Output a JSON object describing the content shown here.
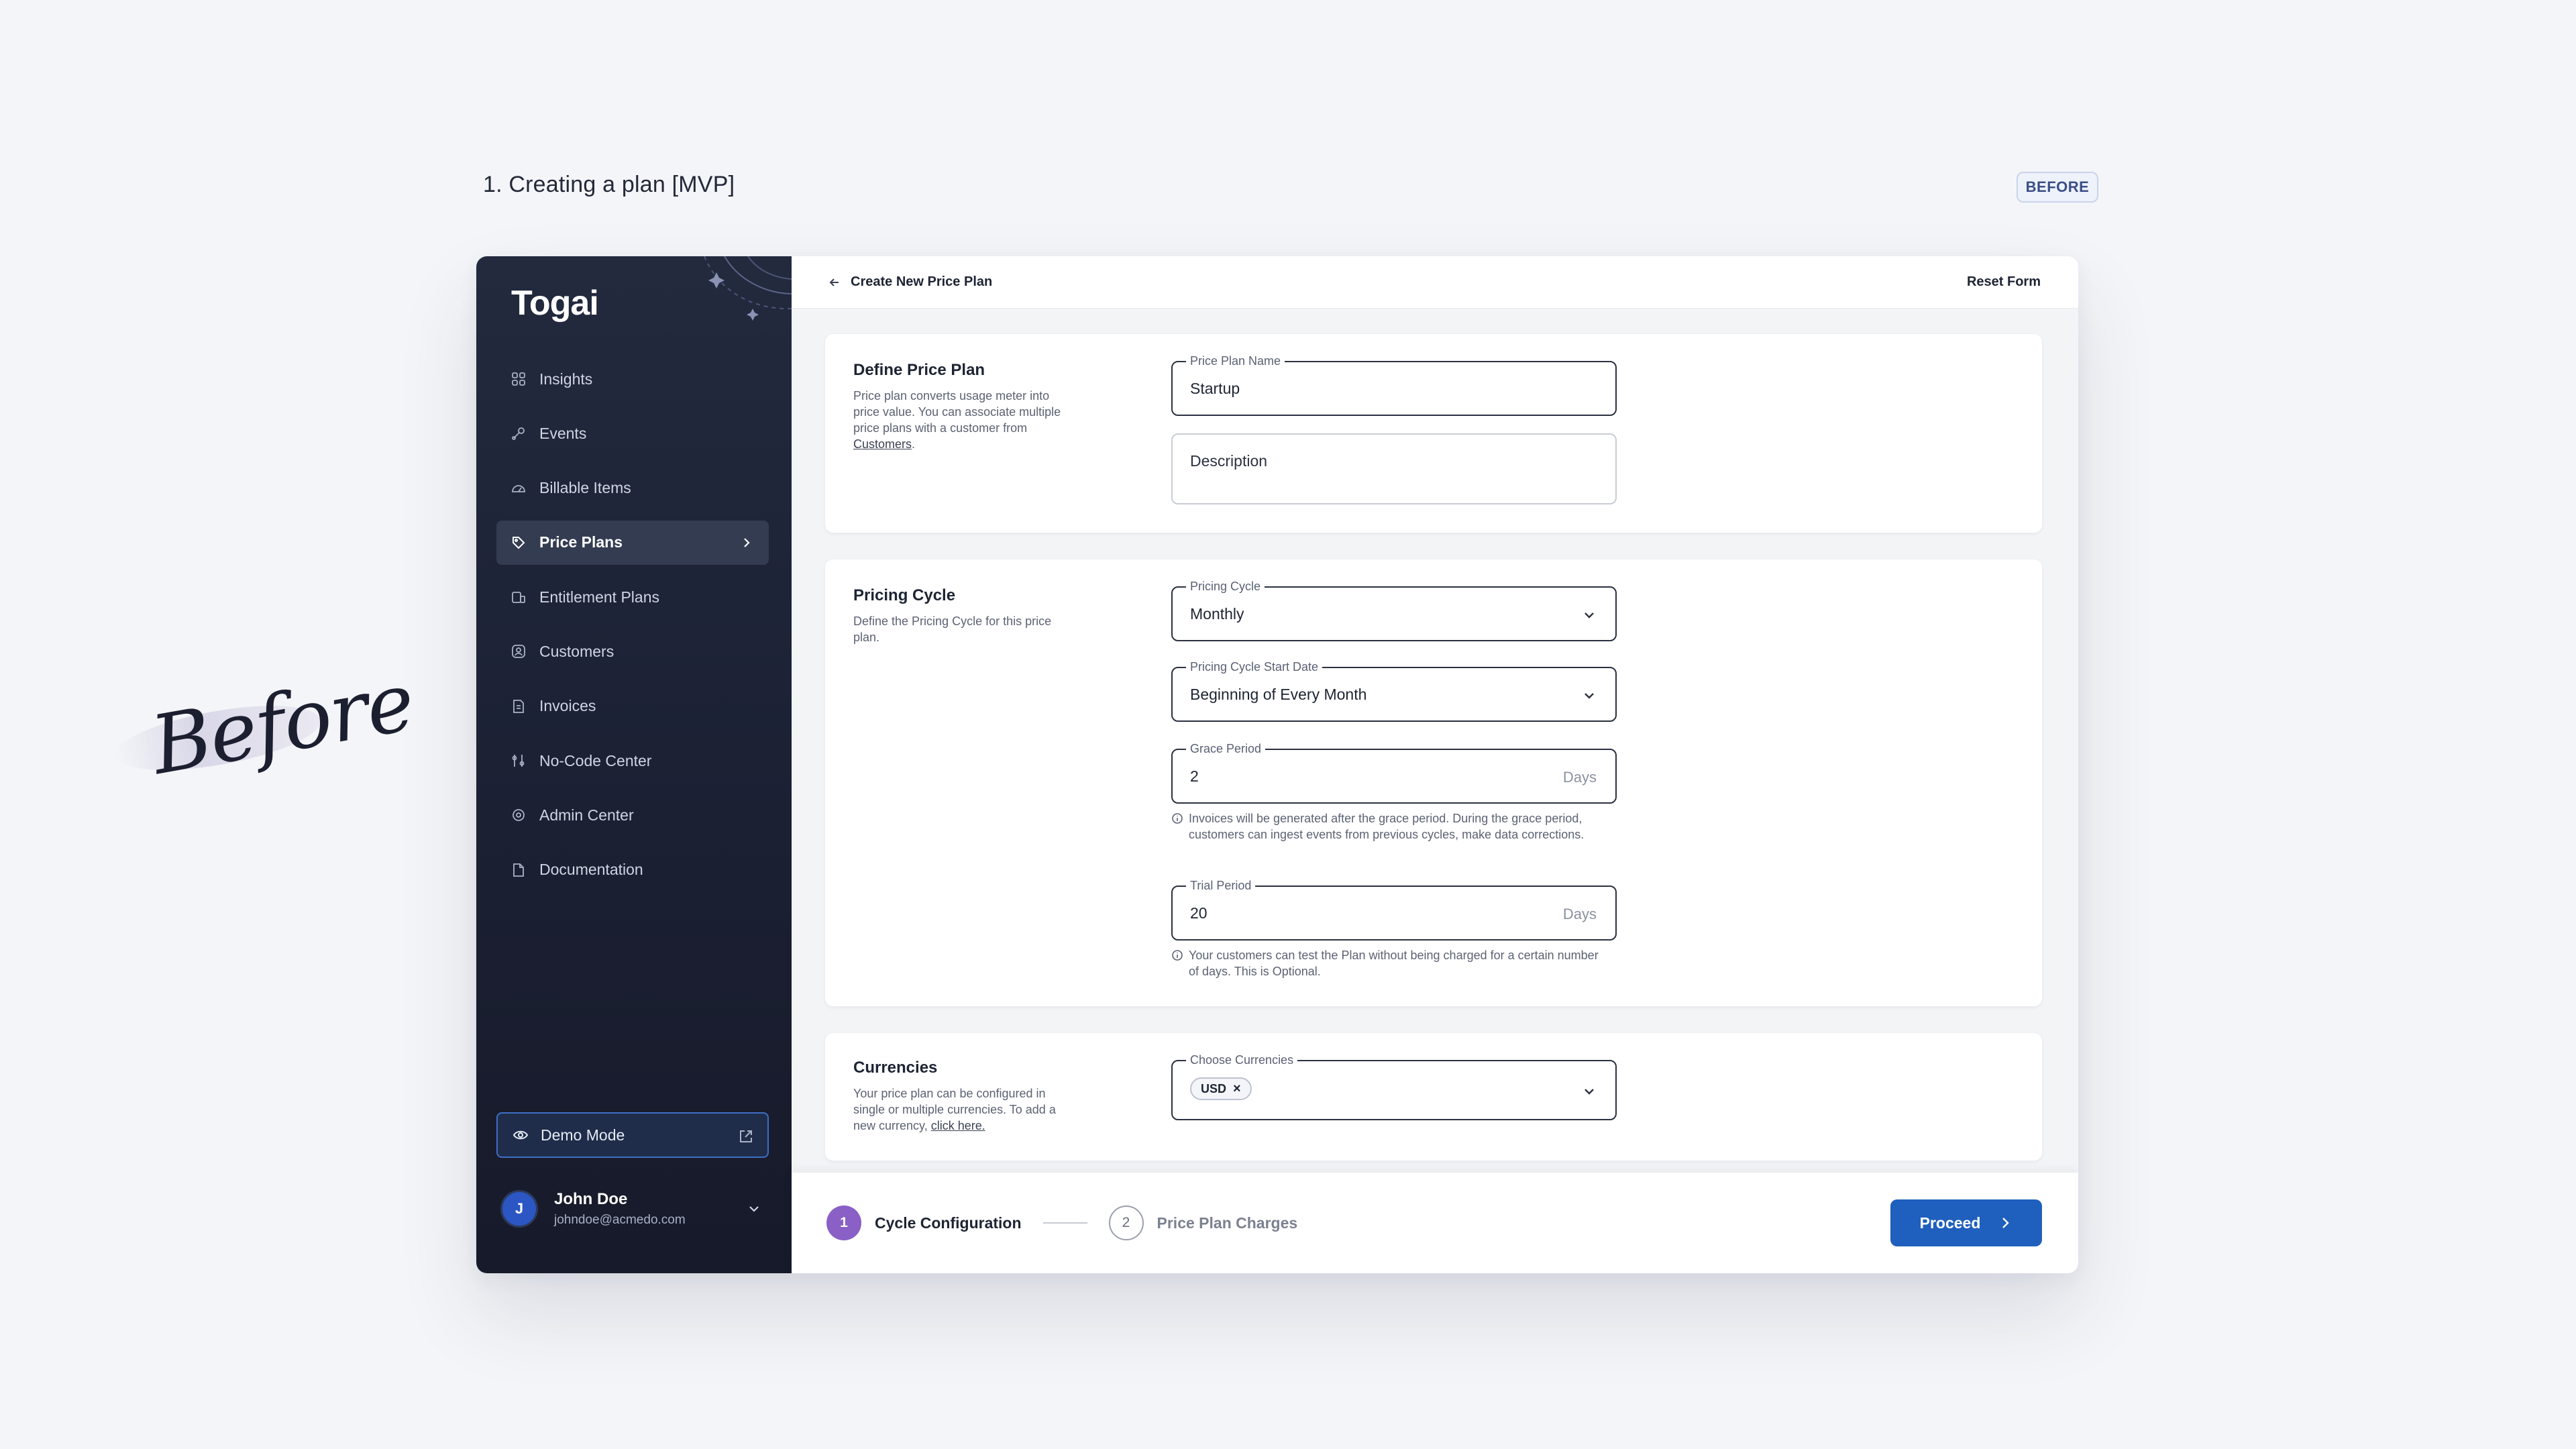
{
  "page": {
    "heading": "1. Creating a plan [MVP]",
    "badge": "BEFORE",
    "handwritten_label": "Before"
  },
  "app": {
    "logo": "Togai",
    "nav": [
      {
        "label": "Insights",
        "icon": "grid-icon"
      },
      {
        "label": "Events",
        "icon": "event-icon"
      },
      {
        "label": "Billable Items",
        "icon": "meter-icon"
      },
      {
        "label": "Price Plans",
        "icon": "tag-icon",
        "active": true
      },
      {
        "label": "Entitlement Plans",
        "icon": "entitlement-icon"
      },
      {
        "label": "Customers",
        "icon": "customers-icon"
      },
      {
        "label": "Invoices",
        "icon": "invoice-icon"
      },
      {
        "label": "No-Code Center",
        "icon": "nocode-icon"
      },
      {
        "label": "Admin Center",
        "icon": "admin-icon"
      },
      {
        "label": "Documentation",
        "icon": "document-icon"
      }
    ],
    "demo_mode": "Demo Mode",
    "user": {
      "initial": "J",
      "name": "John Doe",
      "email": "johndoe@acmedo.com"
    }
  },
  "topbar": {
    "title": "Create New Price Plan",
    "reset": "Reset Form"
  },
  "define": {
    "title": "Define Price Plan",
    "desc_pre": "Price plan converts usage meter into price value. You can associate multiple price plans with a customer from ",
    "desc_link": "Customers",
    "desc_post": ".",
    "name_label": "Price Plan Name",
    "name_value": "Startup",
    "description_placeholder": "Description"
  },
  "cycle": {
    "title": "Pricing Cycle",
    "desc": "Define the Pricing Cycle for this price plan.",
    "cycle_label": "Pricing Cycle",
    "cycle_value": "Monthly",
    "start_label": "Pricing Cycle Start Date",
    "start_value": "Beginning of Every Month",
    "grace_label": "Grace Period",
    "grace_value": "2",
    "grace_unit": "Days",
    "grace_hint": "Invoices will be generated after the grace period. During the grace period, customers can ingest events from previous cycles, make data corrections.",
    "trial_label": "Trial Period",
    "trial_value": "20",
    "trial_unit": "Days",
    "trial_hint": "Your customers can test the Plan without being charged for a certain number of days. This is Optional."
  },
  "currencies": {
    "title": "Currencies",
    "desc_pre": "Your price plan can be configured in single or multiple currencies. To add a new currency, ",
    "desc_link": "click here.",
    "label": "Choose Currencies",
    "chip": "USD"
  },
  "footer": {
    "steps": [
      {
        "num": "1",
        "label": "Cycle Configuration"
      },
      {
        "num": "2",
        "label": "Price Plan Charges"
      }
    ],
    "proceed": "Proceed"
  },
  "colors": {
    "accent": "#1f5fbd",
    "step_active": "#8a5fc6",
    "sidebar": "#1b2033"
  }
}
